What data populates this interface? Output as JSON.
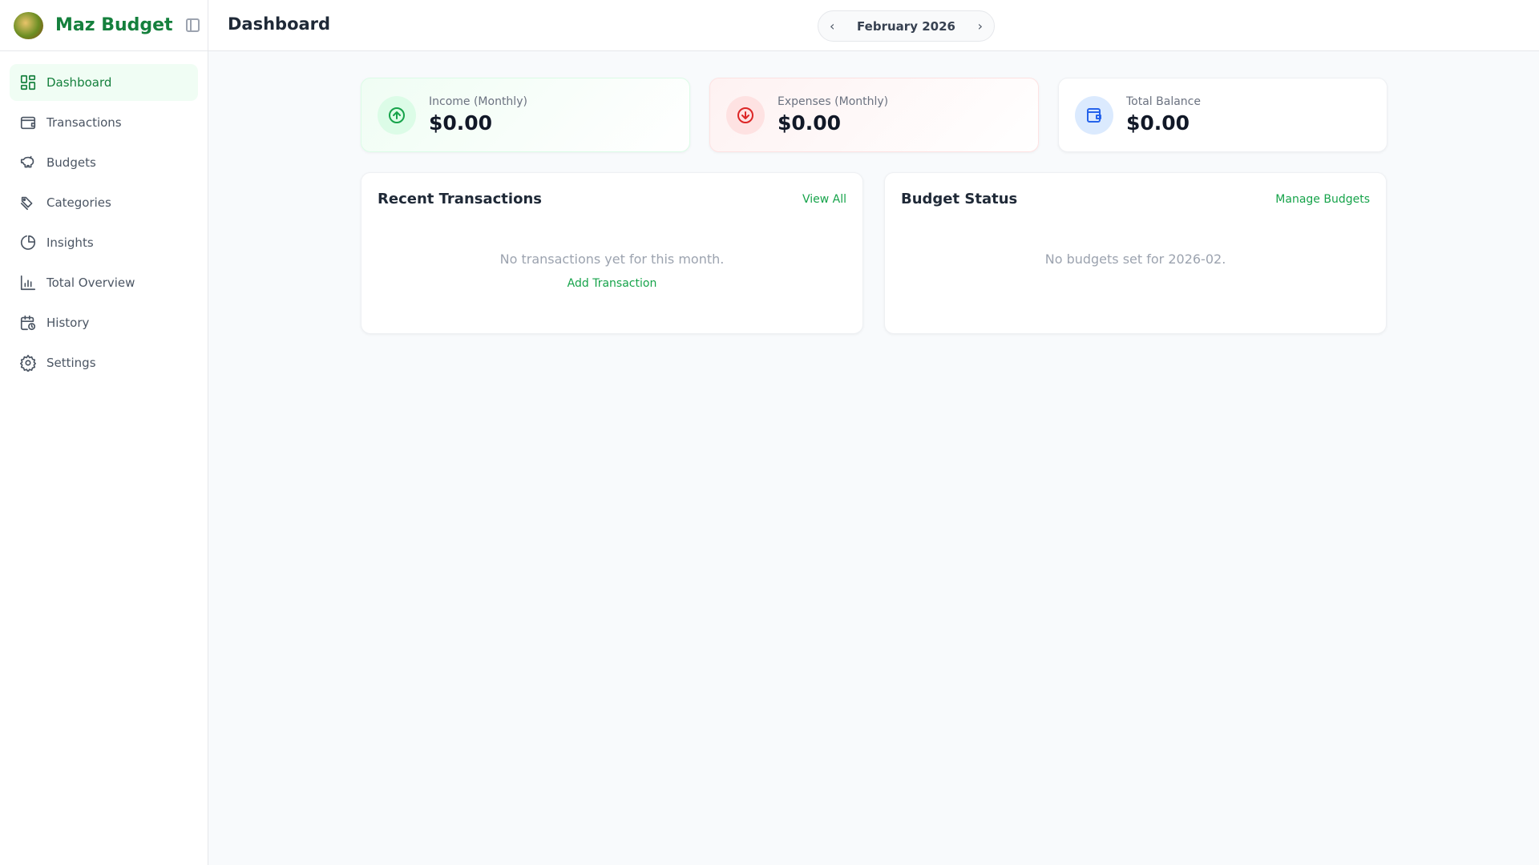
{
  "app": {
    "name": "Maz Budget"
  },
  "sidebar": {
    "items": [
      {
        "label": "Dashboard",
        "icon": "dashboard-icon"
      },
      {
        "label": "Transactions",
        "icon": "wallet-icon"
      },
      {
        "label": "Budgets",
        "icon": "piggy-bank-icon"
      },
      {
        "label": "Categories",
        "icon": "tags-icon"
      },
      {
        "label": "Insights",
        "icon": "pie-chart-icon"
      },
      {
        "label": "Total Overview",
        "icon": "bar-chart-icon"
      },
      {
        "label": "History",
        "icon": "calendar-clock-icon"
      },
      {
        "label": "Settings",
        "icon": "gear-icon"
      }
    ]
  },
  "header": {
    "title": "Dashboard",
    "month": "February 2026"
  },
  "stats": {
    "income": {
      "label": "Income (Monthly)",
      "value": "$0.00"
    },
    "expenses": {
      "label": "Expenses (Monthly)",
      "value": "$0.00"
    },
    "balance": {
      "label": "Total Balance",
      "value": "$0.00"
    }
  },
  "recent": {
    "title": "Recent Transactions",
    "link": "View All",
    "empty": "No transactions yet for this month.",
    "add": "Add Transaction"
  },
  "budget": {
    "title": "Budget Status",
    "link": "Manage Budgets",
    "empty": "No budgets set for 2026-02."
  },
  "colors": {
    "brand": "#15803d",
    "link": "#16a34a",
    "expense": "#dc2626",
    "balance": "#2563eb"
  }
}
